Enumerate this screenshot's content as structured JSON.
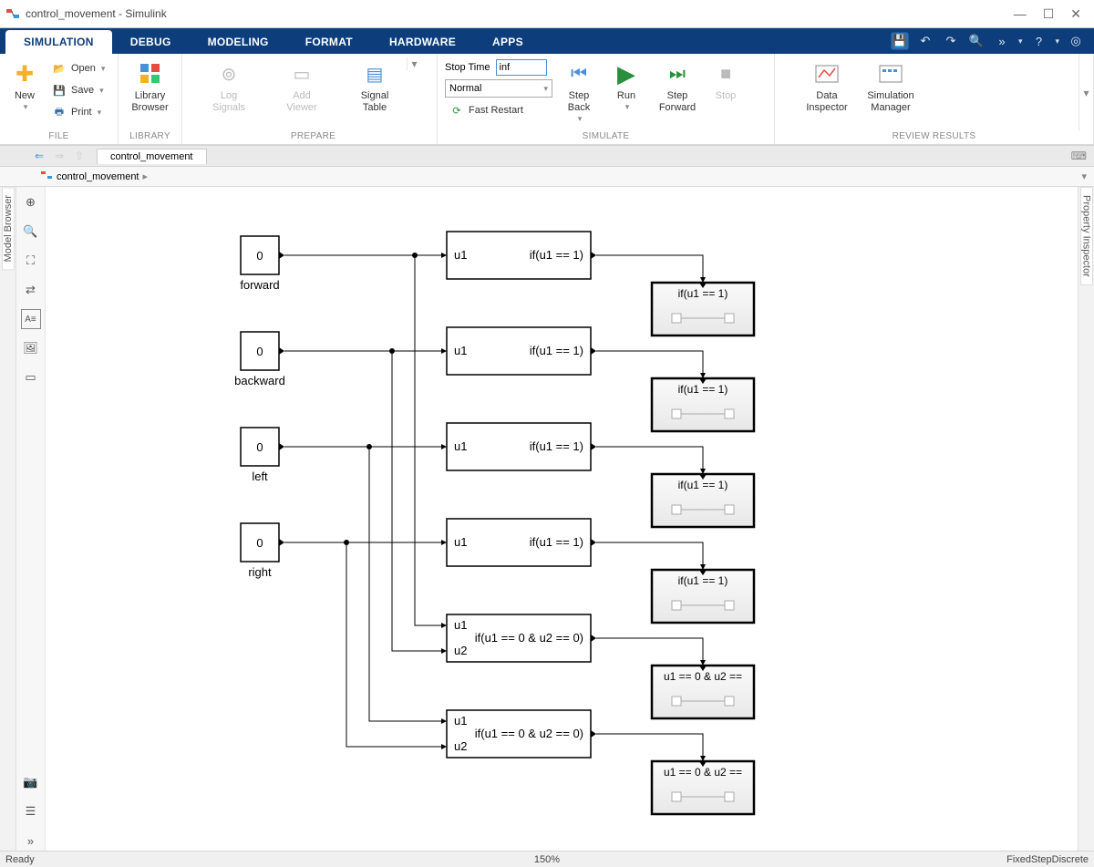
{
  "window": {
    "title": "control_movement - Simulink"
  },
  "win_controls": {
    "min": "—",
    "max": "☐",
    "close": "✕"
  },
  "tabs": {
    "simulation": "SIMULATION",
    "debug": "DEBUG",
    "modeling": "MODELING",
    "format": "FORMAT",
    "hardware": "HARDWARE",
    "apps": "APPS"
  },
  "ribbon": {
    "file": {
      "new": "New",
      "open": "Open",
      "save": "Save",
      "print": "Print",
      "label": "FILE"
    },
    "library": {
      "browser": "Library\nBrowser",
      "label": "LIBRARY"
    },
    "prepare": {
      "log": "Log\nSignals",
      "viewer": "Add\nViewer",
      "signal": "Signal\nTable",
      "label": "PREPARE"
    },
    "simulate": {
      "stoptime_label": "Stop Time",
      "stoptime_value": "inf",
      "mode": "Normal",
      "fast": "Fast Restart",
      "stepback": "Step\nBack",
      "run": "Run",
      "stepfwd": "Step\nForward",
      "stop": "Stop",
      "label": "SIMULATE"
    },
    "review": {
      "data": "Data\nInspector",
      "sim": "Simulation\nManager",
      "label": "REVIEW RESULTS"
    }
  },
  "docs": {
    "tab": "control_movement",
    "breadcrumb": "control_movement"
  },
  "sidebars": {
    "left": "Model Browser",
    "right": "Property Inspector"
  },
  "canvas": {
    "constants": [
      {
        "value": "0",
        "label": "forward"
      },
      {
        "value": "0",
        "label": "backward"
      },
      {
        "value": "0",
        "label": "left"
      },
      {
        "value": "0",
        "label": "right"
      }
    ],
    "ifblocks": [
      {
        "in": [
          "u1"
        ],
        "cond": "if(u1 == 1)"
      },
      {
        "in": [
          "u1"
        ],
        "cond": "if(u1 == 1)"
      },
      {
        "in": [
          "u1"
        ],
        "cond": "if(u1 == 1)"
      },
      {
        "in": [
          "u1"
        ],
        "cond": "if(u1 == 1)"
      },
      {
        "in": [
          "u1",
          "u2"
        ],
        "cond": "if(u1 == 0 & u2 == 0)"
      },
      {
        "in": [
          "u1",
          "u2"
        ],
        "cond": "if(u1 == 0 & u2 == 0)"
      }
    ],
    "subsystems": [
      {
        "label": "if(u1 == 1)"
      },
      {
        "label": "if(u1 == 1)"
      },
      {
        "label": "if(u1 == 1)"
      },
      {
        "label": "if(u1 == 1)"
      },
      {
        "label": "u1 == 0 & u2 =="
      },
      {
        "label": "u1 == 0 & u2 =="
      }
    ]
  },
  "status": {
    "ready": "Ready",
    "zoom": "150%",
    "solver": "FixedStepDiscrete"
  }
}
